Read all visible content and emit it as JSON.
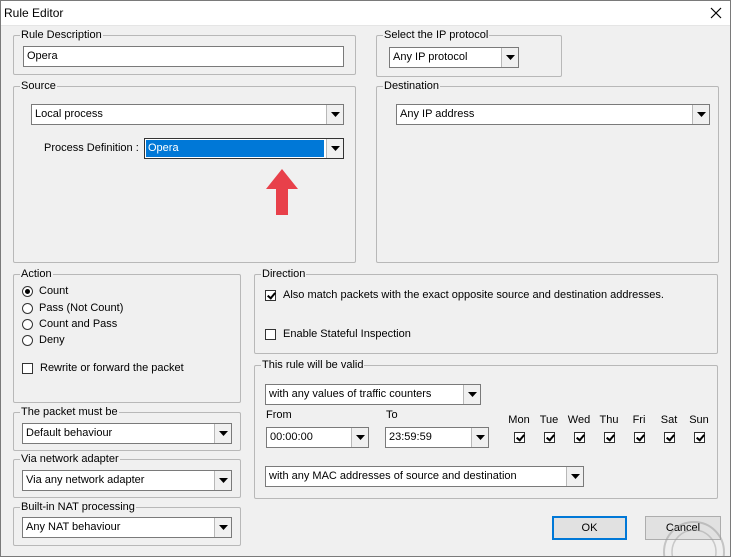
{
  "window": {
    "title": "Rule Editor"
  },
  "rule_description": {
    "legend": "Rule Description",
    "value": "Opera"
  },
  "ip_protocol": {
    "legend": "Select the IP protocol",
    "selected": "Any IP protocol"
  },
  "source": {
    "legend": "Source",
    "selected": "Local process",
    "process_label": "Process Definition :",
    "process_selected": "Opera"
  },
  "destination": {
    "legend": "Destination",
    "selected": "Any IP address"
  },
  "action": {
    "legend": "Action",
    "options": [
      "Count",
      "Pass (Not Count)",
      "Count and Pass",
      "Deny"
    ],
    "selected": "Count",
    "rewrite_label": "Rewrite or forward the packet",
    "rewrite_checked": false
  },
  "direction": {
    "legend": "Direction",
    "match_label": "Also match packets with the exact opposite source and destination addresses.",
    "match_checked": true,
    "stateful_label": "Enable Stateful Inspection",
    "stateful_checked": false
  },
  "validity": {
    "legend": "This rule will be valid",
    "counters_selected": "with any values of traffic counters",
    "from_label": "From",
    "from_value": "00:00:00",
    "to_label": "To",
    "to_value": "23:59:59",
    "days": [
      {
        "label": "Mon",
        "checked": true
      },
      {
        "label": "Tue",
        "checked": true
      },
      {
        "label": "Wed",
        "checked": true
      },
      {
        "label": "Thu",
        "checked": true
      },
      {
        "label": "Fri",
        "checked": true
      },
      {
        "label": "Sat",
        "checked": true
      },
      {
        "label": "Sun",
        "checked": true
      }
    ],
    "mac_selected": "with any MAC addresses of source and destination"
  },
  "packet_must_be": {
    "legend": "The packet must be",
    "selected": "Default behaviour"
  },
  "network_adapter": {
    "legend": "Via network adapter",
    "selected": "Via any network adapter"
  },
  "nat": {
    "legend": "Built-in NAT processing",
    "selected": "Any NAT behaviour"
  },
  "buttons": {
    "ok": "OK",
    "cancel": "Cancel"
  },
  "icons": {
    "close": "close-icon",
    "dropdown": "chevron-down-icon",
    "annotation": "red-up-arrow-icon",
    "watermark": "watermark-logo-icon"
  },
  "colors": {
    "selection": "#0078d7",
    "annotation_arrow": "#e8404a"
  }
}
